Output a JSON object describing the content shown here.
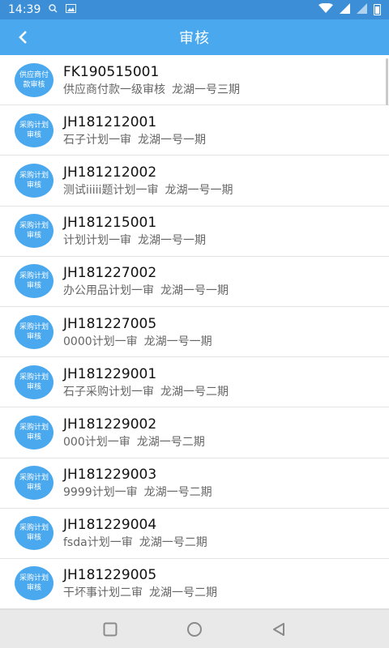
{
  "status_bar": {
    "time": "14:39",
    "left_icons": [
      "search-icon",
      "image-icon"
    ],
    "right_icons": [
      "wifi-icon",
      "signal-icon",
      "signal-icon",
      "battery-icon"
    ]
  },
  "header": {
    "title": "审核",
    "back_icon": "chevron-left-icon"
  },
  "colors": {
    "primary": "#4aa8ee",
    "status_bar": "#3c8fd7"
  },
  "items": [
    {
      "badge_line1": "供应商付",
      "badge_line2": "款审核",
      "code": "FK190515001",
      "type": "供应商付款一级审核",
      "project": "龙湖一号三期"
    },
    {
      "badge_line1": "采购计划",
      "badge_line2": "审核",
      "code": "JH181212001",
      "type": "石子计划一审",
      "project": "龙湖一号一期"
    },
    {
      "badge_line1": "采购计划",
      "badge_line2": "审核",
      "code": "JH181212002",
      "type": "测试iiiii题计划一审",
      "project": "龙湖一号一期"
    },
    {
      "badge_line1": "采购计划",
      "badge_line2": "审核",
      "code": "JH181215001",
      "type": "计划计划一审",
      "project": "龙湖一号一期"
    },
    {
      "badge_line1": "采购计划",
      "badge_line2": "审核",
      "code": "JH181227002",
      "type": "办公用品计划一审",
      "project": "龙湖一号一期"
    },
    {
      "badge_line1": "采购计划",
      "badge_line2": "审核",
      "code": "JH181227005",
      "type": "0000计划一审",
      "project": "龙湖一号一期"
    },
    {
      "badge_line1": "采购计划",
      "badge_line2": "审核",
      "code": "JH181229001",
      "type": "石子采购计划一审",
      "project": "龙湖一号二期"
    },
    {
      "badge_line1": "采购计划",
      "badge_line2": "审核",
      "code": "JH181229002",
      "type": "000计划一审",
      "project": "龙湖一号二期"
    },
    {
      "badge_line1": "采购计划",
      "badge_line2": "审核",
      "code": "JH181229003",
      "type": "9999计划一审",
      "project": "龙湖一号二期"
    },
    {
      "badge_line1": "采购计划",
      "badge_line2": "审核",
      "code": "JH181229004",
      "type": "fsda计划一审",
      "project": "龙湖一号二期"
    },
    {
      "badge_line1": "采购计划",
      "badge_line2": "审核",
      "code": "JH181229005",
      "type": "干坏事计划二审",
      "project": "龙湖一号二期"
    }
  ],
  "nav_bar": {
    "icons": [
      "square-icon",
      "circle-icon",
      "triangle-back-icon"
    ]
  }
}
